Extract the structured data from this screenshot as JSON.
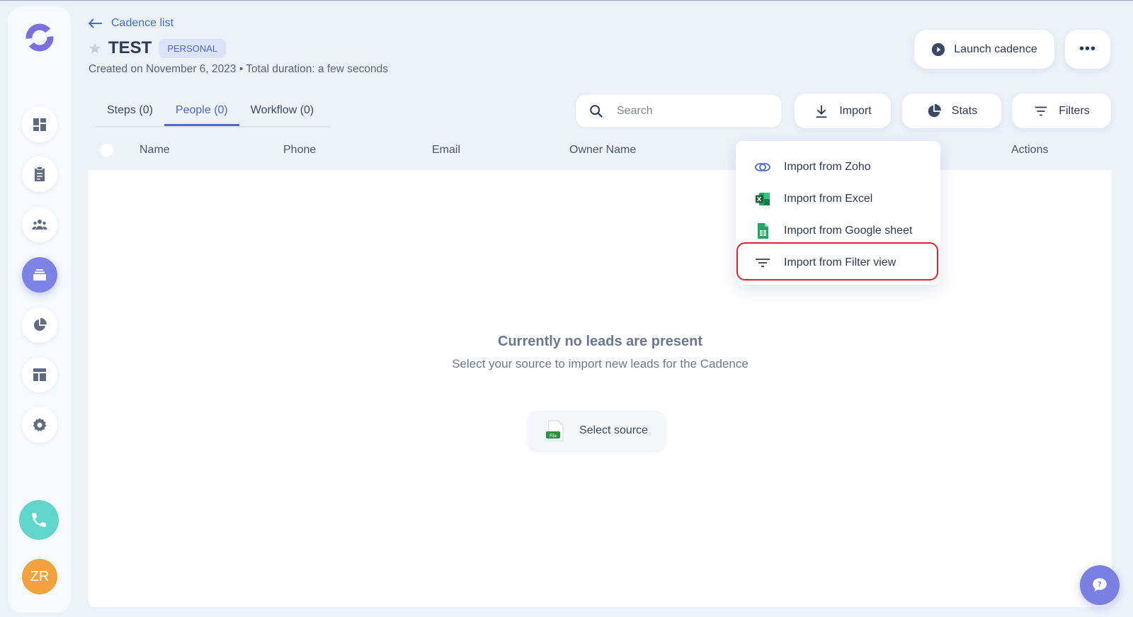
{
  "header": {
    "back_label": "Cadence list",
    "title": "TEST",
    "badge": "PERSONAL",
    "subtitle": "Created on November 6, 2023 • Total duration: a few seconds",
    "launch_label": "Launch cadence",
    "more_label": "•••"
  },
  "tabs": [
    {
      "label": "Steps (0)",
      "active": false
    },
    {
      "label": "People (0)",
      "active": true
    },
    {
      "label": "Workflow (0)",
      "active": false
    }
  ],
  "toolbar": {
    "search_placeholder": "Search",
    "import_label": "Import",
    "stats_label": "Stats",
    "filters_label": "Filters"
  },
  "table": {
    "columns": [
      "Name",
      "Phone",
      "Email",
      "Owner Name",
      "Actions"
    ]
  },
  "empty_state": {
    "title": "Currently no leads are present",
    "subtitle": "Select your source to import new leads for the Cadence",
    "button_label": "Select source",
    "file_icon_text": "File"
  },
  "import_menu": {
    "items": [
      {
        "label": "Import from Zoho",
        "icon": "zoho-icon"
      },
      {
        "label": "Import from Excel",
        "icon": "excel-icon"
      },
      {
        "label": "Import from Google sheet",
        "icon": "google-sheet-icon"
      },
      {
        "label": "Import from Filter view",
        "icon": "filter-icon"
      }
    ]
  },
  "user": {
    "initials": "ZR"
  },
  "colors": {
    "accent": "#5265c9",
    "link": "#3a6fe0",
    "active_nav": "#7d83e6",
    "call": "#5fd6c9",
    "avatar": "#f2a33f",
    "highlight": "#d9232d"
  }
}
